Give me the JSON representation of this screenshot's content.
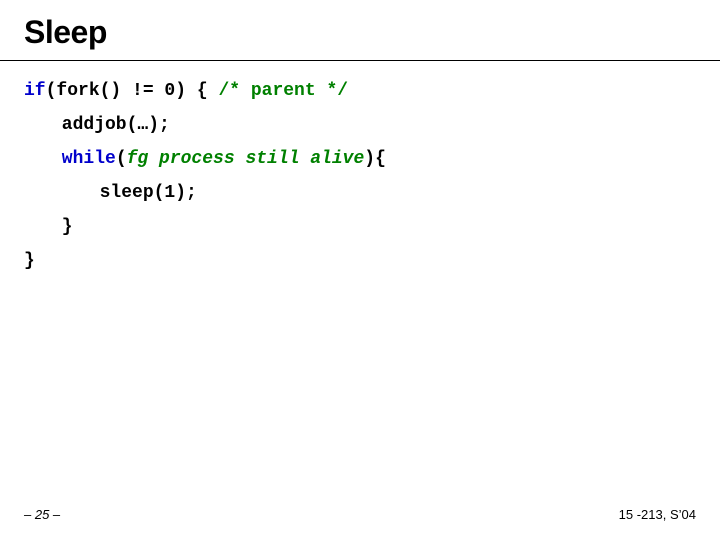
{
  "title": "Sleep",
  "code": {
    "l1_a": "if",
    "l1_b": "(fork() != 0) { ",
    "l1_c": "/* parent */",
    "l2": "addjob(…);",
    "l3_a": "while",
    "l3_b": "(",
    "l3_c": "fg process still alive",
    "l3_d": "){",
    "l4": "sleep(1);",
    "l5": "}",
    "l6": "}"
  },
  "footer": {
    "left": "– 25 –",
    "right": "15 -213, S’04"
  }
}
